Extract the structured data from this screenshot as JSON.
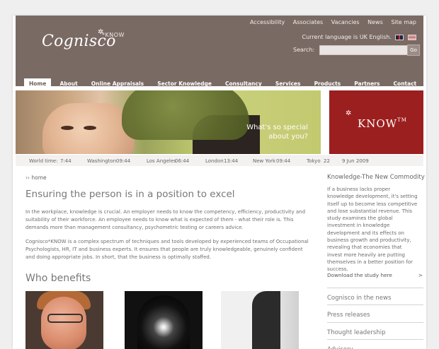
{
  "top_links": [
    "Accessibility",
    "Associates",
    "Vacancies",
    "News",
    "Site map"
  ],
  "language": {
    "text": "Current language is UK English."
  },
  "search": {
    "label": "Search:",
    "placeholder": "",
    "button": "Go"
  },
  "logo": {
    "text": "Cognisco",
    "suffix": "*KNOW"
  },
  "nav": [
    "Home",
    "About",
    "Online Appraisals",
    "Sector Knowledge",
    "Consultancy",
    "Services",
    "Products",
    "Partners",
    "Contact"
  ],
  "hero": {
    "line1": "What's so special",
    "line2": "about you?"
  },
  "know_panel": {
    "text": "KNOW",
    "tm": "TM"
  },
  "world_time": {
    "label": "World time:",
    "items": [
      {
        "city": "",
        "time": "7:44"
      },
      {
        "city": "Washington",
        "time": "09:44"
      },
      {
        "city": "Los Angeles",
        "time": "06:44"
      },
      {
        "city": "London",
        "time": "13:44"
      },
      {
        "city": "New York",
        "time": "09:44"
      },
      {
        "city": "Tokyo",
        "time": "22"
      }
    ],
    "date": "9 Jun 2009"
  },
  "breadcrumb": "›› home",
  "main": {
    "heading": "Ensuring the person is in a position to excel",
    "para1": "In the workplace, knowledge is crucial. An employer needs to know the competency, efficiency, productivity and suitability of their workforce. An employee needs to know what is expected of them - what their role is. This demands more than management consultancy, psychometric testing or careers advice.",
    "para2": "Cognisco*KNOW is a complex spectrum of techniques and tools developed by experienced teams of Occupational Psychologists, HR, IT and business experts. It ensures that people are truly knowledgeable, genuinely confident and doing appropriate jobs. In short, that the business is optimally staffed.",
    "who_heading": "Who benefits"
  },
  "sidebar": {
    "title": "Knowledge-The New Commodity",
    "body": "If a business lacks proper knowledge development, it's setting itself up to become less competitive and lose substantial revenue. This study examines the global investment in knowledge development and its effects on business growth and productivity, revealing that economies that invest more heavily are putting themselves in a better position for success.",
    "download": "Download the study here",
    "download_arrow": ">",
    "menu": [
      "Cognisco in the news",
      "Press releases",
      "Thought leadership",
      "Advisory"
    ]
  }
}
